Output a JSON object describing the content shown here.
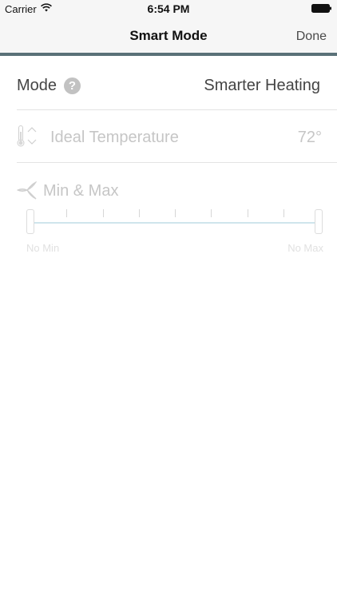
{
  "status_bar": {
    "carrier": "Carrier",
    "time": "6:54 PM",
    "wifi_icon": "wifi-icon",
    "battery_icon": "battery-icon"
  },
  "nav": {
    "title": "Smart Mode",
    "done_label": "Done",
    "accent_color": "#5a7178"
  },
  "mode_row": {
    "label": "Mode",
    "help_icon": "question-icon",
    "help_glyph": "?",
    "value": "Smarter Heating"
  },
  "temperature_row": {
    "icon": "thermometer-icon",
    "stepper_icon": "up-down-chevron-icon",
    "label": "Ideal Temperature",
    "value": "72°"
  },
  "minmax": {
    "icon": "fan-icon",
    "label": "Min & Max",
    "tick_count": 7,
    "track_color": "#cfe5ec",
    "min_label": "No Min",
    "max_label": "No Max"
  }
}
